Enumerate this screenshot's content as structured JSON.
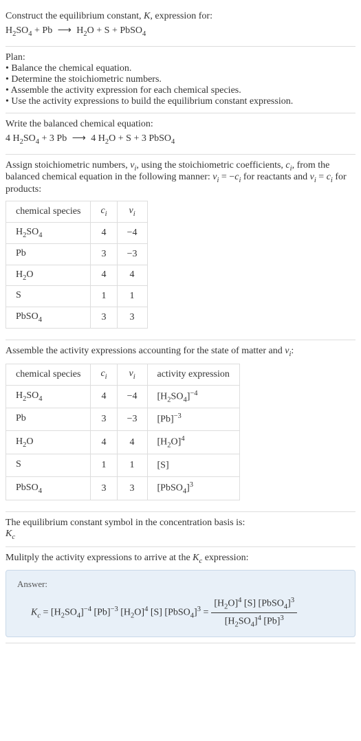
{
  "header": {
    "line1_prefix": "Construct the equilibrium constant, ",
    "K": "K",
    "line1_suffix": ", expression for:",
    "reaction_lhs1": "H",
    "reaction_lhs1_sub": "2",
    "reaction_lhs2": "SO",
    "reaction_lhs2_sub": "4",
    "plus1": " + Pb ",
    "arrow": "⟶",
    "rhs": " H",
    "rhs_sub": "2",
    "rhs2": "O + S + PbSO",
    "rhs2_sub": "4"
  },
  "plan": {
    "title": "Plan:",
    "b1": "• Balance the chemical equation.",
    "b2": "• Determine the stoichiometric numbers.",
    "b3": "• Assemble the activity expression for each chemical species.",
    "b4": "• Use the activity expressions to build the equilibrium constant expression."
  },
  "balanced": {
    "intro": "Write the balanced chemical equation:",
    "c1": "4 H",
    "s1": "2",
    "c2": "SO",
    "s2": "4",
    "c3": " + 3 Pb ",
    "arrow": "⟶",
    "c4": " 4 H",
    "s4": "2",
    "c5": "O + S + 3 PbSO",
    "s5": "4"
  },
  "assign": {
    "p1": "Assign stoichiometric numbers, ",
    "vi": "ν",
    "vi_sub": "i",
    "p2": ", using the stoichiometric coefficients, ",
    "ci": "c",
    "ci_sub": "i",
    "p3": ", from the balanced chemical equation in the following manner: ",
    "eq1a": "ν",
    "eq1a_sub": "i",
    "eq1b": " = −",
    "eq1c": "c",
    "eq1c_sub": "i",
    "p4": " for reactants and ",
    "eq2a": "ν",
    "eq2a_sub": "i",
    "eq2b": " = ",
    "eq2c": "c",
    "eq2c_sub": "i",
    "p5": " for products:"
  },
  "table1": {
    "h1": "chemical species",
    "h2": "c",
    "h2_sub": "i",
    "h3": "ν",
    "h3_sub": "i",
    "rows": [
      {
        "sp_a": "H",
        "sp_as": "2",
        "sp_b": "SO",
        "sp_bs": "4",
        "c": "4",
        "v": "−4"
      },
      {
        "sp_a": "Pb",
        "sp_as": "",
        "sp_b": "",
        "sp_bs": "",
        "c": "3",
        "v": "−3"
      },
      {
        "sp_a": "H",
        "sp_as": "2",
        "sp_b": "O",
        "sp_bs": "",
        "c": "4",
        "v": "4"
      },
      {
        "sp_a": "S",
        "sp_as": "",
        "sp_b": "",
        "sp_bs": "",
        "c": "1",
        "v": "1"
      },
      {
        "sp_a": "PbSO",
        "sp_as": "4",
        "sp_b": "",
        "sp_bs": "",
        "c": "3",
        "v": "3"
      }
    ]
  },
  "assemble": {
    "p1": "Assemble the activity expressions accounting for the state of matter and ",
    "vi": "ν",
    "vi_sub": "i",
    "p2": ":"
  },
  "table2": {
    "h1": "chemical species",
    "h2": "c",
    "h2_sub": "i",
    "h3": "ν",
    "h3_sub": "i",
    "h4": "activity expression",
    "rows": [
      {
        "sp_a": "H",
        "sp_as": "2",
        "sp_b": "SO",
        "sp_bs": "4",
        "c": "4",
        "v": "−4",
        "ae_a": "[H",
        "ae_as": "2",
        "ae_b": "SO",
        "ae_bs": "4",
        "ae_c": "]",
        "ae_exp": "−4"
      },
      {
        "sp_a": "Pb",
        "sp_as": "",
        "sp_b": "",
        "sp_bs": "",
        "c": "3",
        "v": "−3",
        "ae_a": "[Pb]",
        "ae_as": "",
        "ae_b": "",
        "ae_bs": "",
        "ae_c": "",
        "ae_exp": "−3"
      },
      {
        "sp_a": "H",
        "sp_as": "2",
        "sp_b": "O",
        "sp_bs": "",
        "c": "4",
        "v": "4",
        "ae_a": "[H",
        "ae_as": "2",
        "ae_b": "O]",
        "ae_bs": "",
        "ae_c": "",
        "ae_exp": "4"
      },
      {
        "sp_a": "S",
        "sp_as": "",
        "sp_b": "",
        "sp_bs": "",
        "c": "1",
        "v": "1",
        "ae_a": "[S]",
        "ae_as": "",
        "ae_b": "",
        "ae_bs": "",
        "ae_c": "",
        "ae_exp": ""
      },
      {
        "sp_a": "PbSO",
        "sp_as": "4",
        "sp_b": "",
        "sp_bs": "",
        "c": "3",
        "v": "3",
        "ae_a": "[PbSO",
        "ae_as": "4",
        "ae_b": "]",
        "ae_bs": "",
        "ae_c": "",
        "ae_exp": "3"
      }
    ]
  },
  "symbol": {
    "line": "The equilibrium constant symbol in the concentration basis is:",
    "K": "K",
    "K_sub": "c"
  },
  "multiply": {
    "p1": "Mulitply the activity expressions to arrive at the ",
    "K": "K",
    "K_sub": "c",
    "p2": " expression:"
  },
  "answer": {
    "label": "Answer:",
    "K": "K",
    "K_sub": "c",
    "eq": " = ",
    "t1": "[H",
    "t1s": "2",
    "t2": "SO",
    "t2s": "4",
    "t3": "]",
    "e1": "−4",
    "t4": " [Pb]",
    "e2": "−3",
    "t5": " [H",
    "t5s": "2",
    "t6": "O]",
    "e3": "4",
    "t7": " [S] [PbSO",
    "t7s": "4",
    "t8": "]",
    "e4": "3",
    "eq2": " = ",
    "num1": "[H",
    "num1s": "2",
    "num2": "O]",
    "ne1": "4",
    "num3": " [S] [PbSO",
    "num3s": "4",
    "num4": "]",
    "ne2": "3",
    "den1": "[H",
    "den1s": "2",
    "den2": "SO",
    "den2s": "4",
    "den3": "]",
    "de1": "4",
    "den4": " [Pb]",
    "de2": "3"
  }
}
